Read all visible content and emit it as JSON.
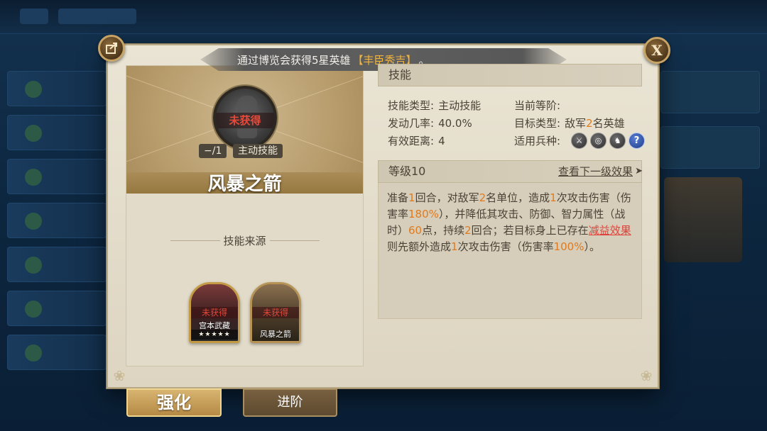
{
  "banner": {
    "prefix": "通过博览会获得5星英雄",
    "hero": "【丰臣秀吉】",
    "suffix": "。"
  },
  "buttons": {
    "close_label": "X"
  },
  "skill": {
    "status": "未获得",
    "level_tag": "−/1",
    "type_tag": "主动技能",
    "name": "风暴之箭"
  },
  "source": {
    "title": "技能来源",
    "cards": [
      {
        "status": "未获得",
        "name": "宫本武藏",
        "stars": "★★★★★"
      },
      {
        "status": "未获得",
        "name": "风暴之箭"
      }
    ]
  },
  "skill_section": {
    "heading": "技能",
    "type_label": "技能类型:",
    "type_value": "主动技能",
    "tier_label": "当前等阶:",
    "tier_value": "",
    "rate_label": "发动几率:",
    "rate_value": "40.0%",
    "target_label": "目标类型:",
    "target_pre": "敌军",
    "target_num": "2",
    "target_post": "名英雄",
    "range_label": "有效距离:",
    "range_value": "4",
    "troop_label": "适用兵种:",
    "troop_icons": [
      "sword-icon",
      "bow-target-icon",
      "cavalry-icon",
      "question-icon"
    ]
  },
  "level_section": {
    "level": "等级10",
    "next_label": "查看下一级效果"
  },
  "description": {
    "p1": "准备",
    "n1": "1",
    "p2": "回合，对敌军",
    "n2": "2",
    "p3": "名单位，造成",
    "n3": "1",
    "p4": "次攻击伤害（伤害率",
    "n4": "180%",
    "p5": "），并降低其攻击、防御、智力属性（战时）",
    "n5": "60",
    "p6": "点，持续",
    "n6": "2",
    "p7": "回合；若目标身上已存在",
    "neg": "减益效果",
    "p8": "则先额外造成",
    "n7": "1",
    "p9": "次攻击伤害（伤害率",
    "n8": "100%",
    "p10": "）。"
  },
  "bottom": {
    "enhance": "强化",
    "advance": "进阶"
  },
  "colors": {
    "highlight": "#e07a1d",
    "negative": "#e0413a",
    "banner_hero": "#f0b440"
  }
}
